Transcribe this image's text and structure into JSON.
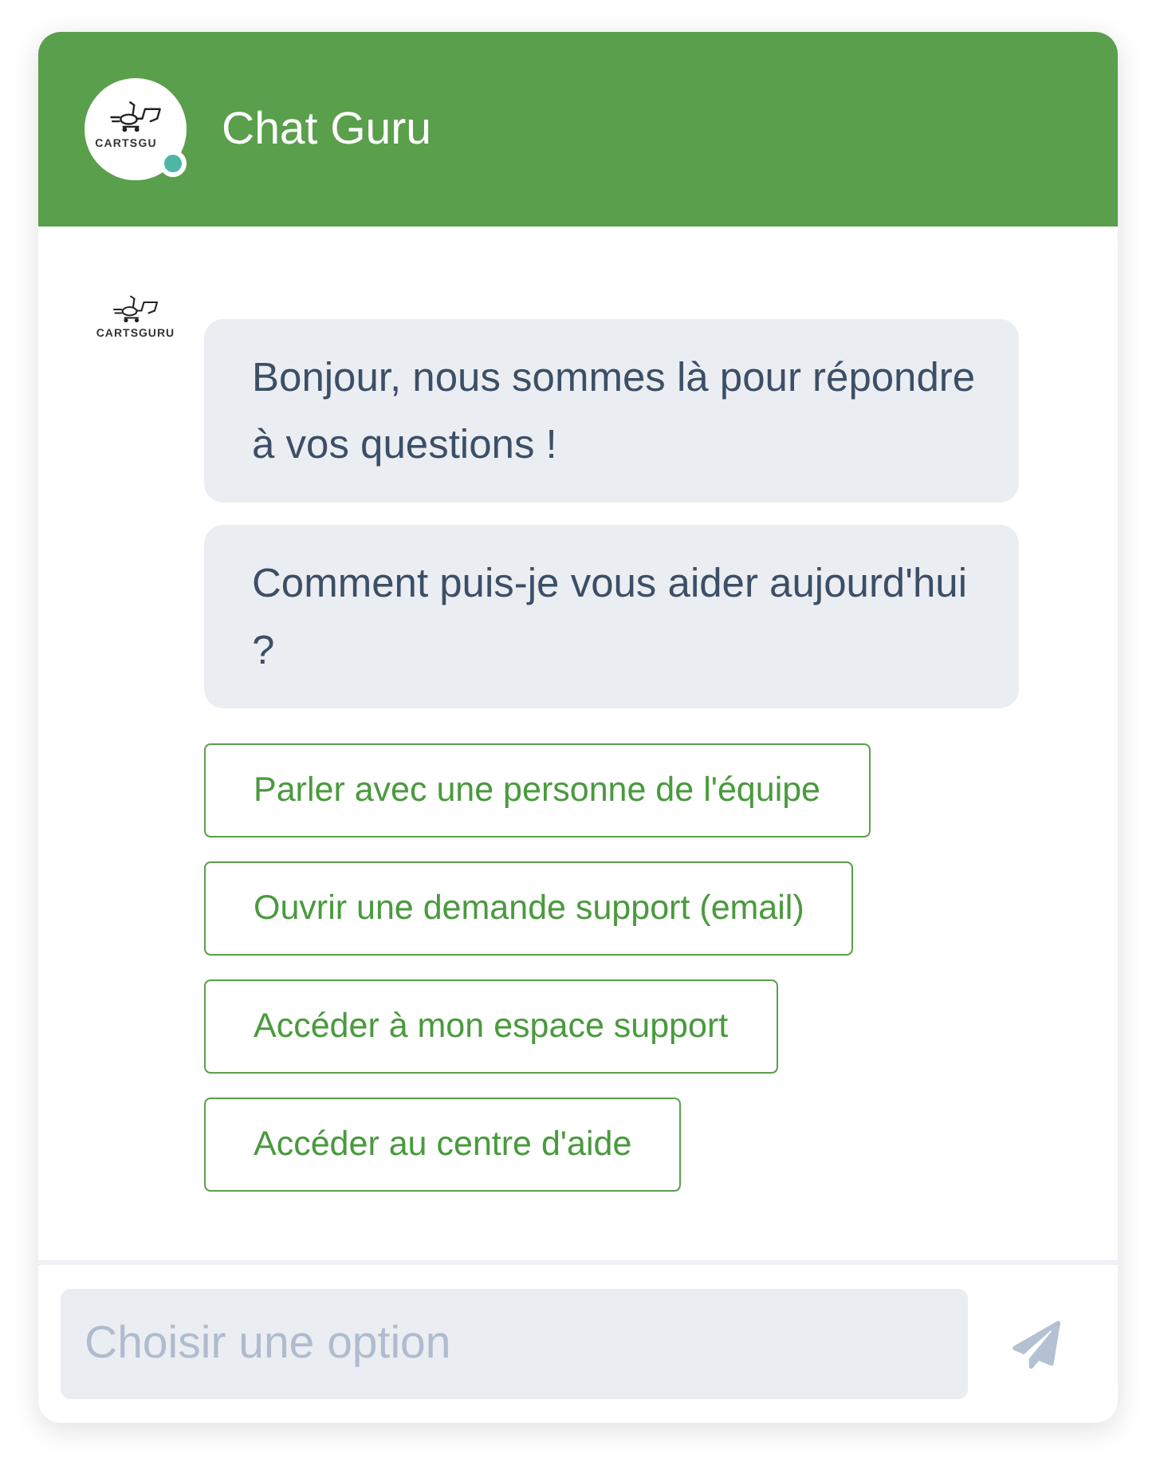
{
  "header": {
    "logo_text": "CARTSGU",
    "online": true,
    "title": "Chat Guru"
  },
  "conversation": {
    "bot_logo_text": "CARTSGURU",
    "messages": [
      "Bonjour, nous sommes là pour répondre à vos questions !",
      "Comment puis-je vous aider aujourd'hui ?"
    ],
    "quick_replies": [
      "Parler avec une personne de l'équipe",
      "Ouvrir une demande support (email)",
      "Accéder à mon espace support",
      "Accéder au centre d'aide"
    ]
  },
  "composer": {
    "placeholder": "Choisir une option"
  }
}
